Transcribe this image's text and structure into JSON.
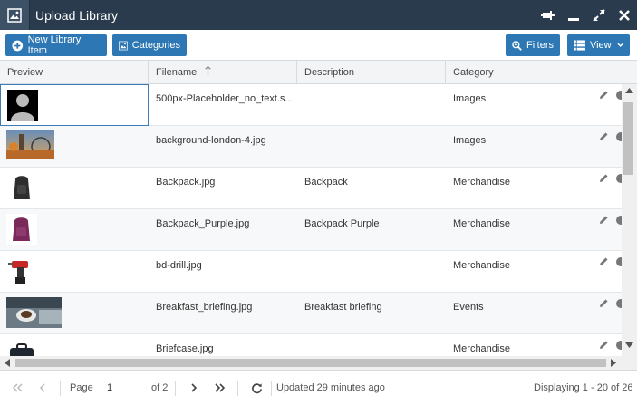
{
  "window": {
    "title": "Upload Library",
    "icon": "image-icon"
  },
  "toolbar": {
    "new_item_label": "New Library Item",
    "categories_label": "Categories",
    "filters_label": "Filters",
    "view_label": "View"
  },
  "columns": {
    "preview": "Preview",
    "filename": "Filename",
    "description": "Description",
    "category": "Category"
  },
  "rows": [
    {
      "filename": "500px-Placeholder_no_text.s...",
      "description": "",
      "category": "Images",
      "thumb": "placeholder-avatar"
    },
    {
      "filename": "background-london-4.jpg",
      "description": "",
      "category": "Images",
      "thumb": "london-photo"
    },
    {
      "filename": "Backpack.jpg",
      "description": "Backpack",
      "category": "Merchandise",
      "thumb": "backpack-black"
    },
    {
      "filename": "Backpack_Purple.jpg",
      "description": "Backpack Purple",
      "category": "Merchandise",
      "thumb": "backpack-purple"
    },
    {
      "filename": "bd-drill.jpg",
      "description": "",
      "category": "Merchandise",
      "thumb": "drill"
    },
    {
      "filename": "Breakfast_briefing.jpg",
      "description": "Breakfast briefing",
      "category": "Events",
      "thumb": "coffee-laptop"
    },
    {
      "filename": "Briefcase.jpg",
      "description": "",
      "category": "Merchandise",
      "thumb": "briefcase"
    }
  ],
  "pager": {
    "page_label": "Page",
    "page_value": "1",
    "of_pages": "of 2",
    "updated": "Updated 29 minutes ago",
    "displaying": "Displaying 1 - 20 of 26"
  },
  "colors": {
    "titlebar": "#2a3b4d",
    "accent": "#2d78b4"
  }
}
